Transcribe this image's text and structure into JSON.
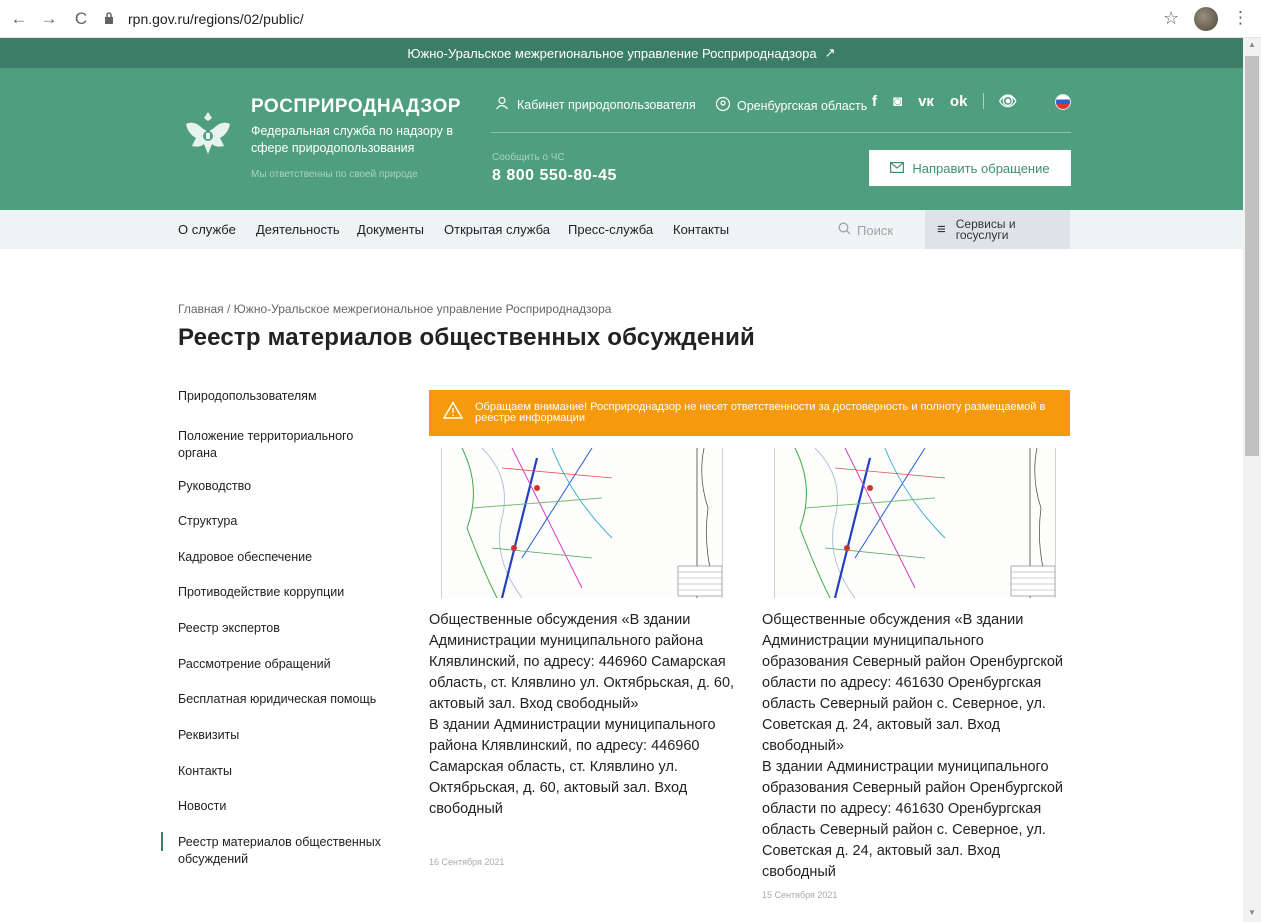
{
  "browser": {
    "url": "rpn.gov.ru/regions/02/public/",
    "back_icon": "←",
    "forward_icon": "→",
    "reload_icon": "C",
    "star_icon": "☆",
    "menu_icon": "⋮"
  },
  "top_strip": {
    "text": "Южно-Уральское межрегиональное управление Росприроднадзора",
    "arrow": "↗"
  },
  "header": {
    "brand": "РОСПРИРОДНАДЗОР",
    "subtitle": "Федеральная служба по надзору в сфере природопользования",
    "motto": "Мы ответственны по своей природе",
    "cabinet": "Кабинет природопользователя",
    "region": "Оренбургская область",
    "socials": [
      "f",
      "◙",
      "vк",
      "ok",
      "👁"
    ],
    "emergency_label": "Сообщить о ЧС",
    "phone": "8 800 550-80-45",
    "send_button": "Направить обращение",
    "colors": {
      "strip": "#3c7d68",
      "header": "#4f9e80"
    }
  },
  "nav": {
    "items": [
      "О службе",
      "Деятельность",
      "Документы",
      "Открытая служба",
      "Пресс-служба",
      "Контакты"
    ],
    "search_placeholder": "Поиск",
    "services": "Сервисы и госуслуги"
  },
  "breadcrumb": "Главная / Южно-Уральское межрегиональное управление Росприроднадзора",
  "page_title": "Реестр материалов общественных обсуждений",
  "sidebar": {
    "items": [
      "Природопользователям",
      "Положение территориального органа",
      "Руководство",
      "Структура",
      "Кадровое обеспечение",
      "Противодействие коррупции",
      "Реестр экспертов",
      "Рассмотрение обращений",
      "Бесплатная юридическая помощь",
      "Реквизиты",
      "Контакты",
      "Новости",
      "Реестр материалов общественных обсуждений"
    ],
    "active": "Реестр материалов общественных обсуждений"
  },
  "warning": {
    "text": "Обращаем внимание! Росприроднадзор не несет ответственности за достоверность и полноту размещаемой в реестре информации",
    "color": "#f59a0c"
  },
  "cards": [
    {
      "text": "Общественные обсуждения «В здании Администрации муниципального района Клявлинский, по адресу: 446960 Самарская область, ст. Клявлино ул. Октябрьская, д. 60, актовый зал. Вход свободный»\nВ здании Администрации муниципального района Клявлинский, по адресу: 446960 Самарская область, ст. Клявлино ул. Октябрьская, д. 60, актовый зал. Вход свободный",
      "date": "16 Сентября 2021"
    },
    {
      "text": "Общественные обсуждения «В здании Администрации муниципального образования Северный район Оренбургской области по адресу: 461630 Оренбургская область Северный район с. Северное, ул. Советская д. 24, актовый зал. Вход свободный»\nВ здании Администрации муниципального образования Северный район Оренбургской области по адресу: 461630 Оренбургская область Северный район с. Северное, ул. Советская д. 24, актовый зал. Вход свободный",
      "date": "15 Сентября 2021"
    }
  ]
}
